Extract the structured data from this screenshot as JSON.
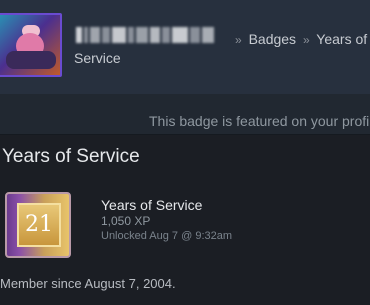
{
  "header": {
    "breadcrumb": {
      "separator": "»",
      "badges_label": "Badges",
      "current_line1": "Years of",
      "current_line2": "Service"
    }
  },
  "featured": {
    "text": "This badge is featured on your profile"
  },
  "section": {
    "title": "Years of Service"
  },
  "badge": {
    "number": "21",
    "name": "Years of Service",
    "xp": "1,050 XP",
    "unlocked": "Unlocked Aug 7 @ 9:32am"
  },
  "member_since": "Member since August 7, 2004."
}
